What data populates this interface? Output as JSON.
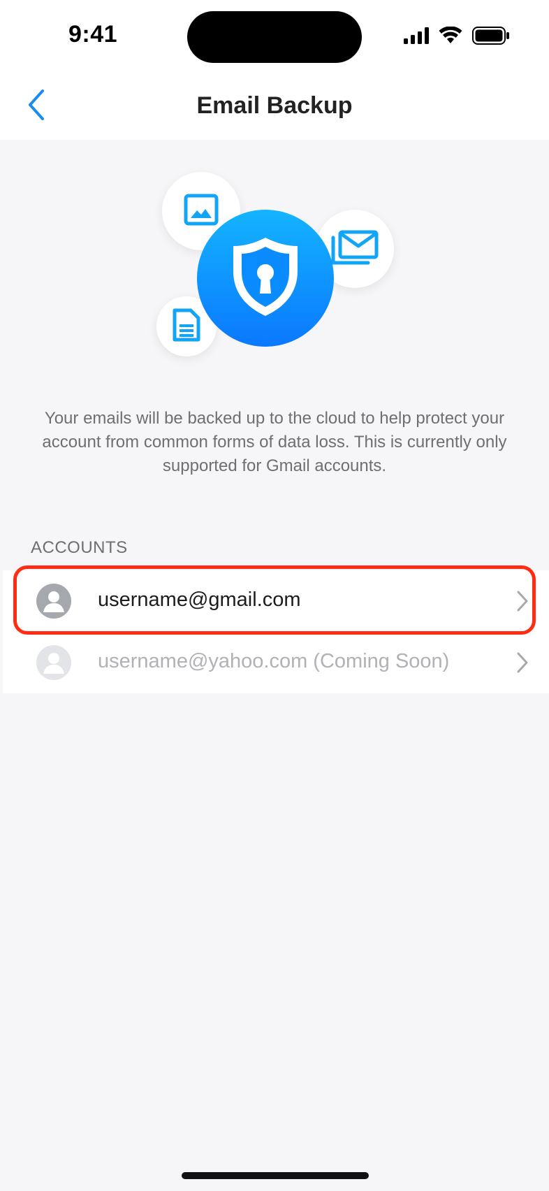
{
  "status_bar": {
    "time": "9:41",
    "icons": [
      "cellular-signal-icon",
      "wifi-icon",
      "battery-icon"
    ]
  },
  "nav": {
    "title": "Email Backup",
    "back_icon": "chevron-left-icon"
  },
  "hero": {
    "icons": [
      "image-icon",
      "mail-icon",
      "document-icon",
      "shield-lock-icon"
    ]
  },
  "description": "Your emails will be backed up to the cloud to help protect your account from common forms of data loss. This is currently only supported for Gmail accounts.",
  "accounts": {
    "section_title": "ACCOUNTS",
    "items": [
      {
        "label": "username@gmail.com",
        "enabled": true
      },
      {
        "label": "username@yahoo.com (Coming Soon)",
        "enabled": false
      }
    ]
  },
  "colors": {
    "accent": "#0a84ff",
    "highlight": "#ff2d14",
    "background": "#f6f6f8"
  }
}
